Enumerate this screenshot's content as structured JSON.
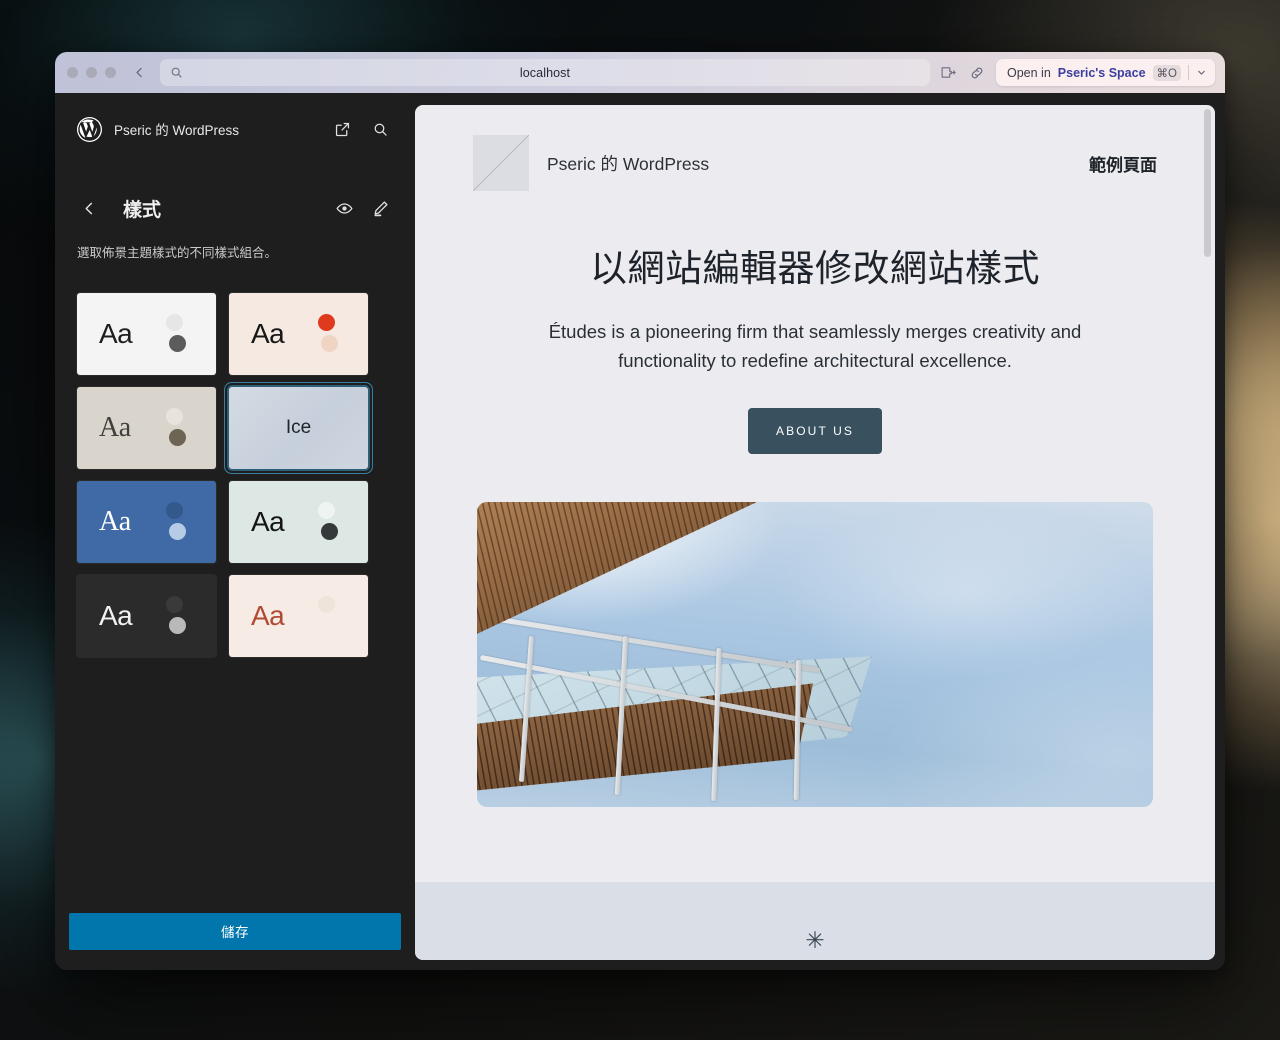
{
  "browser": {
    "url": "localhost",
    "back_icon": "chevron-left-icon",
    "search_icon": "search-icon",
    "extension_icon": "extension-icon",
    "link_icon": "link-icon",
    "open_in_prefix": "Open in",
    "open_in_space": "Pseric's Space",
    "open_in_shortcut": "⌘O",
    "open_in_chevron": "chevron-down-icon"
  },
  "sidebar": {
    "logo_icon": "wordpress-logo-icon",
    "site_title": "Pseric 的 WordPress",
    "external_link_icon": "external-link-icon",
    "search_icon": "search-icon",
    "back_icon": "chevron-left-icon",
    "panel_title": "樣式",
    "eye_icon": "eye-icon",
    "pencil_icon": "pencil-icon",
    "panel_description": "選取佈景主題樣式的不同樣式組合。",
    "variations": [
      {
        "name": "default-light",
        "sample": "Aa",
        "selected": false,
        "bg": "#f4f4f4",
        "text_color": "#1e1e1e",
        "font": "sans",
        "dot1": "#e6e6e6",
        "dot2": "#5c5c5c"
      },
      {
        "name": "canary-cream",
        "sample": "Aa",
        "selected": false,
        "bg": "#f5e9e2",
        "text_color": "#171717",
        "font": "sans",
        "dot1": "#e03a1e",
        "dot2": "#f0d4c3"
      },
      {
        "name": "beige-serif",
        "sample": "Aa",
        "selected": false,
        "bg": "#d9d5cd",
        "text_color": "#41403c",
        "font": "serif",
        "dot1": "#e8e4dc",
        "dot2": "#6d6455"
      },
      {
        "name": "ice",
        "sample": "Ice",
        "selected": true,
        "bg": "#ccd3dd",
        "text_color": "#20242b",
        "font": "sans",
        "dot1": "",
        "dot2": ""
      },
      {
        "name": "blue-serif",
        "sample": "Aa",
        "selected": false,
        "bg": "#3f6aa6",
        "text_color": "#ffffff",
        "font": "serif",
        "dot1": "#33588c",
        "dot2": "#b6cbe6"
      },
      {
        "name": "mint",
        "sample": "Aa",
        "selected": false,
        "bg": "#dde7e3",
        "text_color": "#141414",
        "font": "sans",
        "dot1": "#edf4f1",
        "dot2": "#36393a"
      },
      {
        "name": "dark",
        "sample": "Aa",
        "selected": false,
        "bg": "#2b2b2b",
        "text_color": "#f2f2f2",
        "font": "sans",
        "dot1": "#3a3a3a",
        "dot2": "#b9b9b9"
      },
      {
        "name": "rust-cream",
        "sample": "Aa",
        "selected": false,
        "bg": "#f6ece5",
        "text_color": "#b24a33",
        "font": "sans",
        "dot1": "#efe4da",
        "dot2": ""
      }
    ],
    "save_label": "儲存",
    "save_color": "#0076ad"
  },
  "preview": {
    "logo_icon": "image-placeholder-icon",
    "site_title": "Pseric 的 WordPress",
    "nav_item": "範例頁面",
    "heading": "以網站編輯器修改網站樣式",
    "paragraph": "Études is a pioneering firm that seamlessly merges creativity and functionality to redefine architectural excellence.",
    "cta_label": "ABOUT US",
    "cta_color": "#39505e",
    "photo_alt": "architecture-photo",
    "footer_glyph": "✳"
  }
}
